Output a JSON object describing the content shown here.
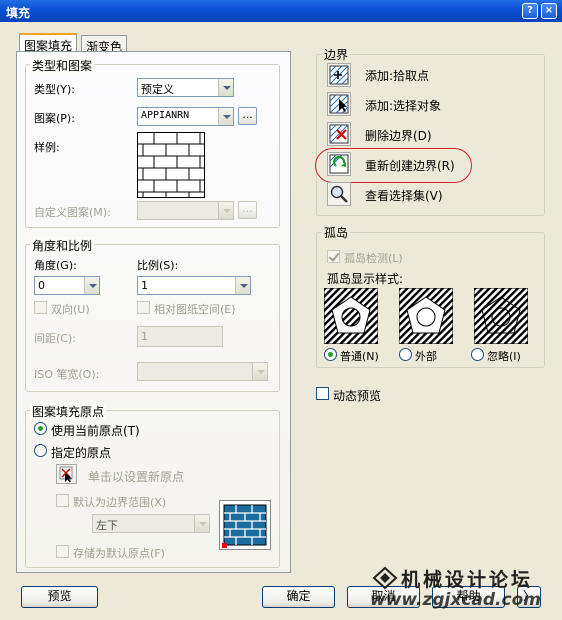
{
  "window": {
    "title": "填充",
    "help_glyph": "?",
    "close_glyph": "×"
  },
  "tabs": [
    {
      "label": "图案填充"
    },
    {
      "label": "渐变色"
    }
  ],
  "type_pattern": {
    "title": "类型和图案",
    "type_label": "类型(Y):",
    "type_value": "预定义",
    "pattern_label": "图案(P):",
    "pattern_value": "APPIANRN",
    "browse_label": "...",
    "sample_label": "样例:",
    "custom_label": "自定义图案(M):",
    "custom_browse": "..."
  },
  "angle_scale": {
    "title": "角度和比例",
    "angle_label": "角度(G):",
    "angle_value": "0",
    "scale_label": "比例(S):",
    "scale_value": "1",
    "double_label": "双向(U)",
    "relative_label": "相对图纸空间(E)",
    "spacing_label": "间距(C):",
    "spacing_value": "1",
    "iso_label": "ISO 笔宽(O):"
  },
  "origin": {
    "title": "图案填充原点",
    "use_current": "使用当前原点(T)",
    "specify": "指定的原点",
    "click_set": "单击以设置新原点",
    "default_extent": "默认为边界范围(X)",
    "position_value": "左下",
    "store_default": "存储为默认原点(F)"
  },
  "boundary": {
    "title": "边界",
    "add_pick": "添加:拾取点",
    "add_select": "添加:选择对象",
    "remove": "删除边界(D)",
    "recreate": "重新创建边界(R)",
    "view_selection": "查看选择集(V)"
  },
  "islands": {
    "title": "孤岛",
    "detect": "孤岛检测(L)",
    "style_label": "孤岛显示样式:",
    "normal": "普通(N)",
    "outer": "外部",
    "ignore": "忽略(I)"
  },
  "dynamic_preview": "动态预览",
  "buttons": {
    "preview": "预览",
    "ok": "确定",
    "cancel": "取消",
    "help": "帮助",
    "more": "〉"
  },
  "watermark": {
    "name": "机械设计论坛",
    "url": "www.zgjxcad.com"
  },
  "colors": {
    "title_bar": "#0a4fd0",
    "dialog_bg": "#ece9d8",
    "highlight_ring": "#d8202a"
  }
}
